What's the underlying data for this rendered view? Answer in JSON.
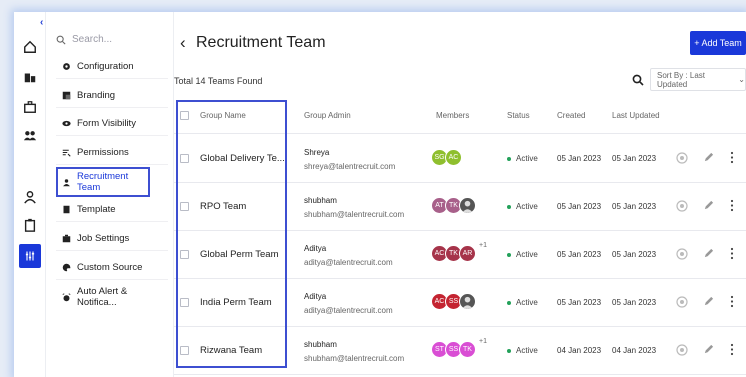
{
  "menu": {
    "search_placeholder": "Search...",
    "items": [
      {
        "label": "Configuration",
        "icon": "gear-icon"
      },
      {
        "label": "Branding",
        "icon": "branding-icon"
      },
      {
        "label": "Form Visibility",
        "icon": "eye-icon"
      },
      {
        "label": "Permissions",
        "icon": "permissions-icon"
      },
      {
        "label": "Recruitment Team",
        "icon": "person-icon",
        "active": true
      },
      {
        "label": "Template",
        "icon": "template-icon"
      },
      {
        "label": "Job Settings",
        "icon": "briefcase-icon"
      },
      {
        "label": "Custom Source",
        "icon": "palette-icon"
      },
      {
        "label": "Auto Alert & Notifica...",
        "icon": "alarm-icon"
      }
    ]
  },
  "header": {
    "title": "Recruitment Team",
    "add_button": "+ Add Team",
    "total": "Total 14 Teams Found",
    "sort_label": "Sort By : Last Updated"
  },
  "table": {
    "columns": [
      "Group Name",
      "Group Admin",
      "Members",
      "Status",
      "Created",
      "Last Updated"
    ],
    "rows": [
      {
        "name": "Global Delivery Te...",
        "admin": "Shreya",
        "email": "shreya@talentrecruit.com",
        "members": [
          {
            "i": "SG",
            "c": "#8fbf2e"
          },
          {
            "i": "AC",
            "c": "#8fbf2e"
          }
        ],
        "more": "",
        "status": "Active",
        "created": "05 Jan 2023",
        "updated": "05 Jan 2023"
      },
      {
        "name": "RPO Team",
        "admin": "shubham",
        "email": "shubham@talentrecruit.com",
        "members": [
          {
            "i": "AT",
            "c": "#a8608a"
          },
          {
            "i": "TK",
            "c": "#a8608a"
          },
          {
            "i": "",
            "c": "#555555",
            "photo": true
          }
        ],
        "more": "",
        "status": "Active",
        "created": "05 Jan 2023",
        "updated": "05 Jan 2023"
      },
      {
        "name": "Global Perm Team",
        "admin": "Aditya",
        "email": "aditya@talentrecruit.com",
        "members": [
          {
            "i": "AC",
            "c": "#a6344a"
          },
          {
            "i": "TK",
            "c": "#a6344a"
          },
          {
            "i": "AR",
            "c": "#a6344a"
          }
        ],
        "more": "+1",
        "status": "Active",
        "created": "05 Jan 2023",
        "updated": "05 Jan 2023"
      },
      {
        "name": "India Perm Team",
        "admin": "Aditya",
        "email": "aditya@talentrecruit.com",
        "members": [
          {
            "i": "AC",
            "c": "#c42431"
          },
          {
            "i": "SS",
            "c": "#c42431"
          },
          {
            "i": "",
            "c": "#555555",
            "photo": true
          }
        ],
        "more": "",
        "status": "Active",
        "created": "05 Jan 2023",
        "updated": "05 Jan 2023"
      },
      {
        "name": "Rizwana Team",
        "admin": "shubham",
        "email": "shubham@talentrecruit.com",
        "members": [
          {
            "i": "ST",
            "c": "#d94ed4"
          },
          {
            "i": "SS",
            "c": "#d94ed4"
          },
          {
            "i": "TK",
            "c": "#d94ed4"
          }
        ],
        "more": "+1",
        "status": "Active",
        "created": "04 Jan 2023",
        "updated": "04 Jan 2023"
      }
    ]
  },
  "colors": {
    "accent": "#1a38d9",
    "active": "#23a15a"
  }
}
